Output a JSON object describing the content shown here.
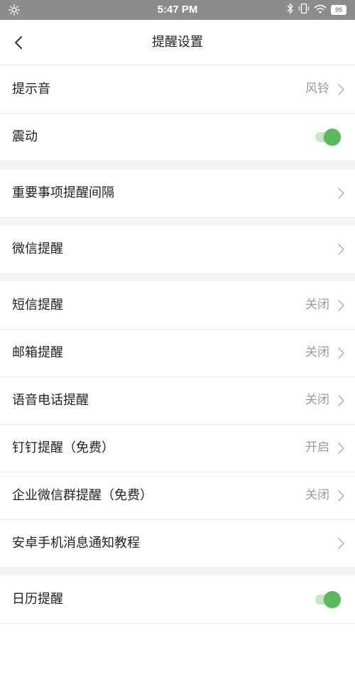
{
  "status_bar": {
    "time": "5:47 PM",
    "battery": "95",
    "icons": [
      "brightness-icon",
      "bluetooth-icon",
      "vibrate-icon",
      "wifi-icon",
      "battery-icon"
    ]
  },
  "header": {
    "title": "提醒设置",
    "back_icon": "chevron-left-icon"
  },
  "settings": {
    "sound": {
      "label": "提示音",
      "value": "风铃"
    },
    "vibration": {
      "label": "震动",
      "enabled": true
    },
    "important_interval": {
      "label": "重要事项提醒间隔"
    },
    "wechat": {
      "label": "微信提醒"
    },
    "sms": {
      "label": "短信提醒",
      "value": "关闭"
    },
    "email": {
      "label": "邮箱提醒",
      "value": "关闭"
    },
    "voice_call": {
      "label": "语音电话提醒",
      "value": "关闭"
    },
    "dingtalk": {
      "label": "钉钉提醒（免费）",
      "value": "开启"
    },
    "wecom_group": {
      "label": "企业微信群提醒（免费）",
      "value": "关闭"
    },
    "android_tutorial": {
      "label": "安卓手机消息通知教程"
    },
    "calendar": {
      "label": "日历提醒",
      "enabled": true
    }
  },
  "colors": {
    "accent": "#5cb85c",
    "status_bar": "#8c8c8c",
    "secondary_text": "#9a9a9a",
    "section_gap": "#f3f3f3"
  }
}
